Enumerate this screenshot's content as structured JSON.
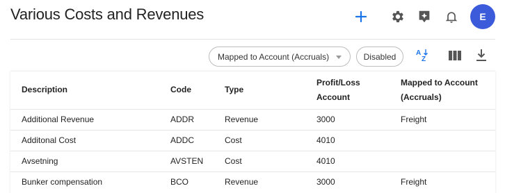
{
  "header": {
    "title": "Various Costs and Revenues",
    "avatar_initial": "E",
    "icons": [
      "add-icon",
      "gear-icon",
      "ai-sparkle-icon",
      "bell-icon"
    ],
    "accent_color": "#1a73e8",
    "avatar_color": "#3b5bdb"
  },
  "toolbar": {
    "filter_select_value": "Mapped to Account (Accruals)",
    "disabled_label": "Disabled",
    "sort_icon_label": "AZ",
    "icons": [
      "sort-az-icon",
      "columns-icon",
      "download-icon"
    ]
  },
  "table": {
    "columns": [
      {
        "label": "Description"
      },
      {
        "label": "Code"
      },
      {
        "label": "Type"
      },
      {
        "label_line1": "Profit/Loss",
        "label_line2": "Account"
      },
      {
        "label_line1": "Mapped to Account",
        "label_line2": "(Accruals)"
      }
    ],
    "rows": [
      {
        "description": "Additional Revenue",
        "code": "ADDR",
        "type": "Revenue",
        "account": "3000",
        "mapped": "Freight"
      },
      {
        "description": "Additonal Cost",
        "code": "ADDC",
        "type": "Cost",
        "account": "4010",
        "mapped": ""
      },
      {
        "description": "Avsetning",
        "code": "AVSTEN",
        "type": "Cost",
        "account": "4010",
        "mapped": ""
      },
      {
        "description": "Bunker compensation",
        "code": "BCO",
        "type": "Revenue",
        "account": "3000",
        "mapped": "Freight"
      }
    ]
  }
}
